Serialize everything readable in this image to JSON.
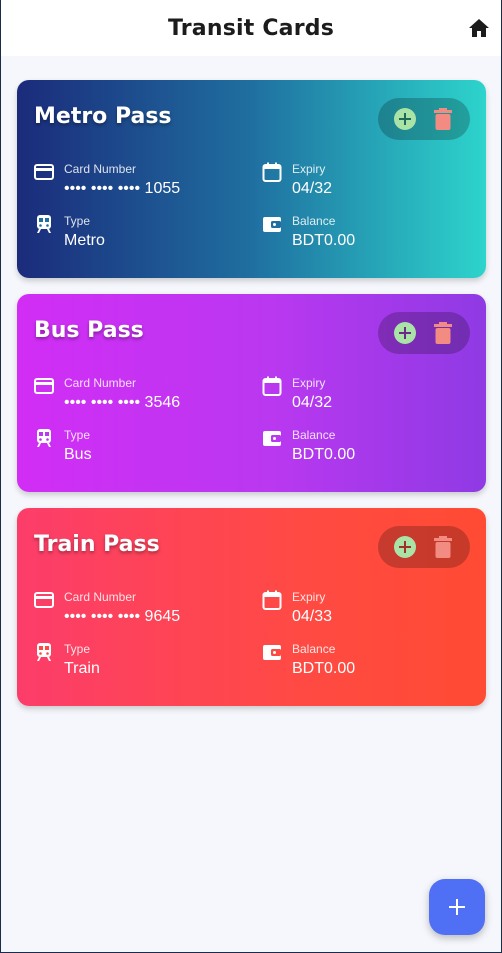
{
  "appbar": {
    "title": "Transit Cards",
    "home_icon": "home-icon"
  },
  "labels": {
    "card_number": "Card Number",
    "expiry": "Expiry",
    "type": "Type",
    "balance": "Balance"
  },
  "cards": [
    {
      "title": "Metro Pass",
      "number": "•••• •••• •••• 1055",
      "expiry": "04/32",
      "type": "Metro",
      "balance": "BDT0.00"
    },
    {
      "title": "Bus Pass",
      "number": "•••• •••• •••• 3546",
      "expiry": "04/32",
      "type": "Bus",
      "balance": "BDT0.00"
    },
    {
      "title": "Train Pass",
      "number": "•••• •••• •••• 9645",
      "expiry": "04/33",
      "type": "Train",
      "balance": "BDT0.00"
    }
  ],
  "colors": {
    "add_icon": "#a9e3a6",
    "delete_icon": "#f28b82",
    "fab": "#4f6ff5"
  },
  "fab": {
    "icon": "plus-icon"
  }
}
